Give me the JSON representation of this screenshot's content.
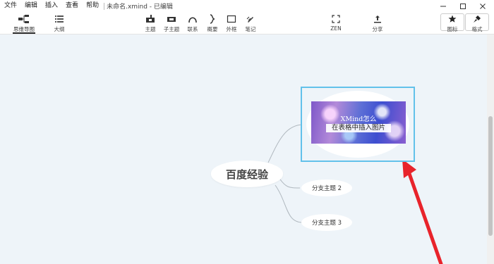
{
  "menu": {
    "items": [
      "文件",
      "编辑",
      "插入",
      "查看",
      "帮助"
    ],
    "document_title": "未命名.xmind - 已编辑"
  },
  "toolbar": {
    "views": [
      {
        "label": "思维导图",
        "icon": "mindmap-icon",
        "active": true
      },
      {
        "label": "大纲",
        "icon": "outline-icon",
        "active": false
      }
    ],
    "insert_tools": [
      {
        "label": "主题",
        "icon": "topic-icon"
      },
      {
        "label": "子主题",
        "icon": "subtopic-icon"
      },
      {
        "label": "联系",
        "icon": "relationship-icon"
      },
      {
        "label": "概要",
        "icon": "summary-icon"
      },
      {
        "label": "外框",
        "icon": "boundary-icon"
      },
      {
        "label": "笔记",
        "icon": "note-icon"
      }
    ],
    "zen_label": "ZEN",
    "share_label": "分享",
    "right_tools": [
      {
        "label": "图标",
        "icon": "star-icon"
      },
      {
        "label": "格式",
        "icon": "brush-icon"
      }
    ]
  },
  "canvas": {
    "root_topic": "百度经验",
    "image_topic_text": [
      "XMind怎么",
      "在表格中插入图片"
    ],
    "subtopics": [
      "分支主题 2",
      "分支主题 3"
    ],
    "annotation_color": "#e8232b",
    "selection_color": "#62c1ea",
    "background_color": "#eef4f9"
  }
}
